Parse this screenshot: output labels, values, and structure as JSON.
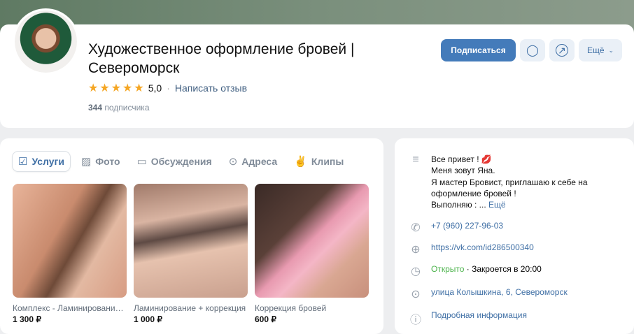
{
  "header": {
    "title": "Художественное оформление бровей | Североморск",
    "rating_value": "5,0",
    "write_review": "Написать отзыв",
    "subscribers_count": "344",
    "subscribers_label": "подписчика",
    "subscribe_button": "Подписаться",
    "more_button": "Ещё"
  },
  "tabs": [
    {
      "label": "Услуги",
      "icon": "calendar-check-icon"
    },
    {
      "label": "Фото",
      "icon": "image-icon"
    },
    {
      "label": "Обсуждения",
      "icon": "chat-icon"
    },
    {
      "label": "Адреса",
      "icon": "pin-icon"
    },
    {
      "label": "Клипы",
      "icon": "clip-icon"
    }
  ],
  "services": [
    {
      "name": "Комплекс - Ламинирование бровей",
      "price": "1 300 ₽"
    },
    {
      "name": "Ламинирование + коррекция",
      "price": "1 000 ₽"
    },
    {
      "name": "Коррекция бровей",
      "price": "600 ₽"
    }
  ],
  "info": {
    "about_lines": [
      "Все привет ! 💋",
      "Меня зовут Яна.",
      "Я мастер Бровист, приглашаю к себе на",
      "оформление бровей !",
      "Выполняю : ..."
    ],
    "about_more": "Ещё",
    "phone": "+7 (960) 227-96-03",
    "url": "https://vk.com/id286500340",
    "open_status": "Открыто",
    "closes": "· Закроется в 20:00",
    "address": "улица Колышкина, 6, Североморск",
    "details": "Подробная информация"
  },
  "colors": {
    "accent": "#447bba",
    "link": "#3f6fa5",
    "open": "#4bb34b",
    "star": "#f5a623"
  }
}
